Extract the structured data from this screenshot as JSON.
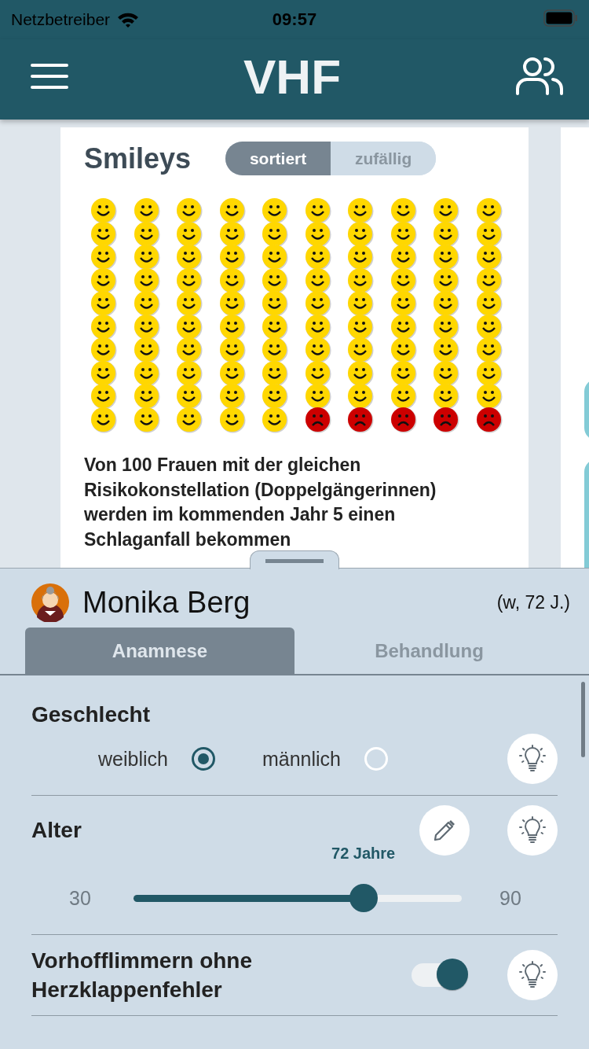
{
  "status_bar": {
    "carrier": "Netzbetreiber",
    "time": "09:57"
  },
  "header": {
    "title": "VHF"
  },
  "smileys_card": {
    "title": "Smileys",
    "segments": [
      {
        "label": "sortiert",
        "selected": true
      },
      {
        "label": "zufällig",
        "selected": false
      }
    ],
    "grid": [
      {
        "faces": [
          {
            "kind": "happy"
          },
          {
            "kind": "happy"
          },
          {
            "kind": "happy"
          },
          {
            "kind": "happy"
          },
          {
            "kind": "happy"
          },
          {
            "kind": "happy"
          },
          {
            "kind": "happy"
          },
          {
            "kind": "happy"
          },
          {
            "kind": "happy"
          },
          {
            "kind": "happy"
          }
        ]
      },
      {
        "faces": [
          {
            "kind": "happy"
          },
          {
            "kind": "happy"
          },
          {
            "kind": "happy"
          },
          {
            "kind": "happy"
          },
          {
            "kind": "happy"
          },
          {
            "kind": "happy"
          },
          {
            "kind": "happy"
          },
          {
            "kind": "happy"
          },
          {
            "kind": "happy"
          },
          {
            "kind": "happy"
          }
        ]
      },
      {
        "faces": [
          {
            "kind": "happy"
          },
          {
            "kind": "happy"
          },
          {
            "kind": "happy"
          },
          {
            "kind": "happy"
          },
          {
            "kind": "happy"
          },
          {
            "kind": "happy"
          },
          {
            "kind": "happy"
          },
          {
            "kind": "happy"
          },
          {
            "kind": "happy"
          },
          {
            "kind": "happy"
          }
        ]
      },
      {
        "faces": [
          {
            "kind": "happy"
          },
          {
            "kind": "happy"
          },
          {
            "kind": "happy"
          },
          {
            "kind": "happy"
          },
          {
            "kind": "happy"
          },
          {
            "kind": "happy"
          },
          {
            "kind": "happy"
          },
          {
            "kind": "happy"
          },
          {
            "kind": "happy"
          },
          {
            "kind": "happy"
          }
        ]
      },
      {
        "faces": [
          {
            "kind": "happy"
          },
          {
            "kind": "happy"
          },
          {
            "kind": "happy"
          },
          {
            "kind": "happy"
          },
          {
            "kind": "happy"
          },
          {
            "kind": "happy"
          },
          {
            "kind": "happy"
          },
          {
            "kind": "happy"
          },
          {
            "kind": "happy"
          },
          {
            "kind": "happy"
          }
        ]
      },
      {
        "faces": [
          {
            "kind": "happy"
          },
          {
            "kind": "happy"
          },
          {
            "kind": "happy"
          },
          {
            "kind": "happy"
          },
          {
            "kind": "happy"
          },
          {
            "kind": "happy"
          },
          {
            "kind": "happy"
          },
          {
            "kind": "happy"
          },
          {
            "kind": "happy"
          },
          {
            "kind": "happy"
          }
        ]
      },
      {
        "faces": [
          {
            "kind": "happy"
          },
          {
            "kind": "happy"
          },
          {
            "kind": "happy"
          },
          {
            "kind": "happy"
          },
          {
            "kind": "happy"
          },
          {
            "kind": "happy"
          },
          {
            "kind": "happy"
          },
          {
            "kind": "happy"
          },
          {
            "kind": "happy"
          },
          {
            "kind": "happy"
          }
        ]
      },
      {
        "faces": [
          {
            "kind": "happy"
          },
          {
            "kind": "happy"
          },
          {
            "kind": "happy"
          },
          {
            "kind": "happy"
          },
          {
            "kind": "happy"
          },
          {
            "kind": "happy"
          },
          {
            "kind": "happy"
          },
          {
            "kind": "happy"
          },
          {
            "kind": "happy"
          },
          {
            "kind": "happy"
          }
        ]
      },
      {
        "faces": [
          {
            "kind": "happy"
          },
          {
            "kind": "happy"
          },
          {
            "kind": "happy"
          },
          {
            "kind": "happy"
          },
          {
            "kind": "happy"
          },
          {
            "kind": "happy"
          },
          {
            "kind": "happy"
          },
          {
            "kind": "happy"
          },
          {
            "kind": "happy"
          },
          {
            "kind": "happy"
          }
        ]
      },
      {
        "faces": [
          {
            "kind": "happy"
          },
          {
            "kind": "happy"
          },
          {
            "kind": "happy"
          },
          {
            "kind": "happy"
          },
          {
            "kind": "happy"
          },
          {
            "kind": "sad"
          },
          {
            "kind": "sad"
          },
          {
            "kind": "sad"
          },
          {
            "kind": "sad"
          },
          {
            "kind": "sad"
          }
        ]
      }
    ],
    "caption": "Von 100 Frauen mit der gleichen Risikokonstellation (Doppelgängerinnen) werden im kommenden Jahr 5 einen Schlaganfall bekommen"
  },
  "patient": {
    "name": "Monika Berg",
    "info": "(w, 72 J.)"
  },
  "tabs": [
    {
      "label": "Anamnese",
      "selected": true
    },
    {
      "label": "Behandlung",
      "selected": false
    }
  ],
  "rows": [
    {
      "kind": "radio",
      "label": "Geschlecht",
      "options": [
        {
          "label": "weiblich",
          "selected": true
        },
        {
          "label": "männlich",
          "selected": false
        }
      ]
    },
    {
      "kind": "slider",
      "label": "Alter",
      "value_label": "72 Jahre",
      "min_label": "30",
      "max_label": "90",
      "level": 0.7
    },
    {
      "kind": "switch",
      "label": "Vorhofflimmern ohne Herzklappenfehler",
      "on": true
    }
  ]
}
